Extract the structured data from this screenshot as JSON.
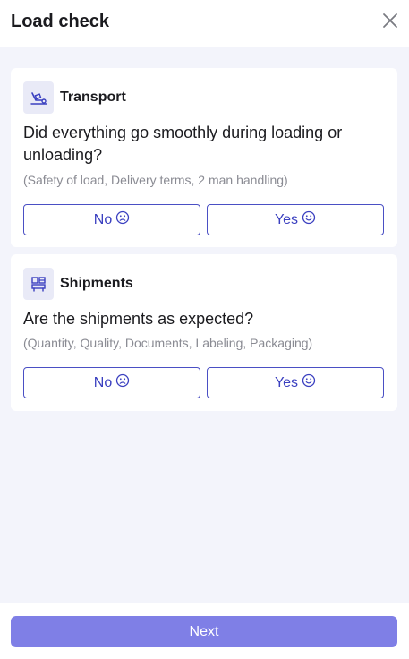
{
  "header": {
    "title": "Load check",
    "close_icon": "close-icon"
  },
  "sections": [
    {
      "title": "Transport",
      "icon": "truck-loading-icon",
      "question": "Did everything go smoothly during loading or unloading?",
      "hint": "(Safety of load, Delivery terms, 2 man handling)",
      "no_label": "No",
      "yes_label": "Yes"
    },
    {
      "title": "Shipments",
      "icon": "boxes-icon",
      "question": "Are the shipments as expected?",
      "hint": "(Quantity, Quality, Documents, Labeling, Packaging)",
      "no_label": "No",
      "yes_label": "Yes"
    }
  ],
  "footer": {
    "next_label": "Next"
  },
  "colors": {
    "accent": "#3b40c0",
    "next_button": "#7f7fe6",
    "background": "#f3f4fb"
  }
}
